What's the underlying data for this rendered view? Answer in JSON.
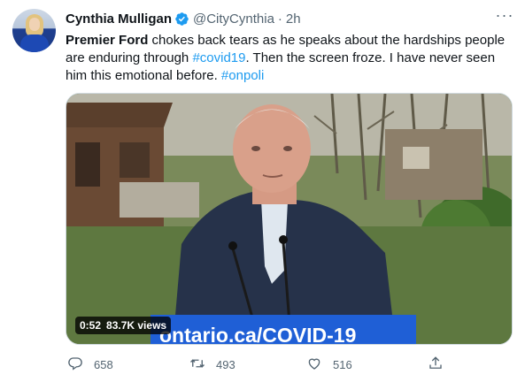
{
  "tweet": {
    "author_name": "Cynthia Mulligan",
    "handle": "@CityCynthia",
    "separator": "·",
    "time": "2h",
    "more_label": "···",
    "text": {
      "part1": "Premier Ford",
      "part2": " chokes back tears as he speaks about the hardships people are enduring through ",
      "hashtag1": "#covid19",
      "part3": ".   Then the screen froze.   I have never seen him this emotional before.  ",
      "hashtag2": "#onpoli"
    },
    "video": {
      "duration": "0:52",
      "views": "83.7K views",
      "podium_sign": "ontario.ca/COVID-19"
    },
    "actions": {
      "reply_icon": "reply-icon",
      "reply_count": "658",
      "retweet_icon": "retweet-icon",
      "retweet_count": "493",
      "like_icon": "heart-icon",
      "like_count": "516",
      "share_icon": "share-icon"
    },
    "colors": {
      "link": "#1d9bf0",
      "secondary_text": "#536471",
      "verified": "#1d9bf0",
      "podium": "#1f5fd6"
    }
  }
}
